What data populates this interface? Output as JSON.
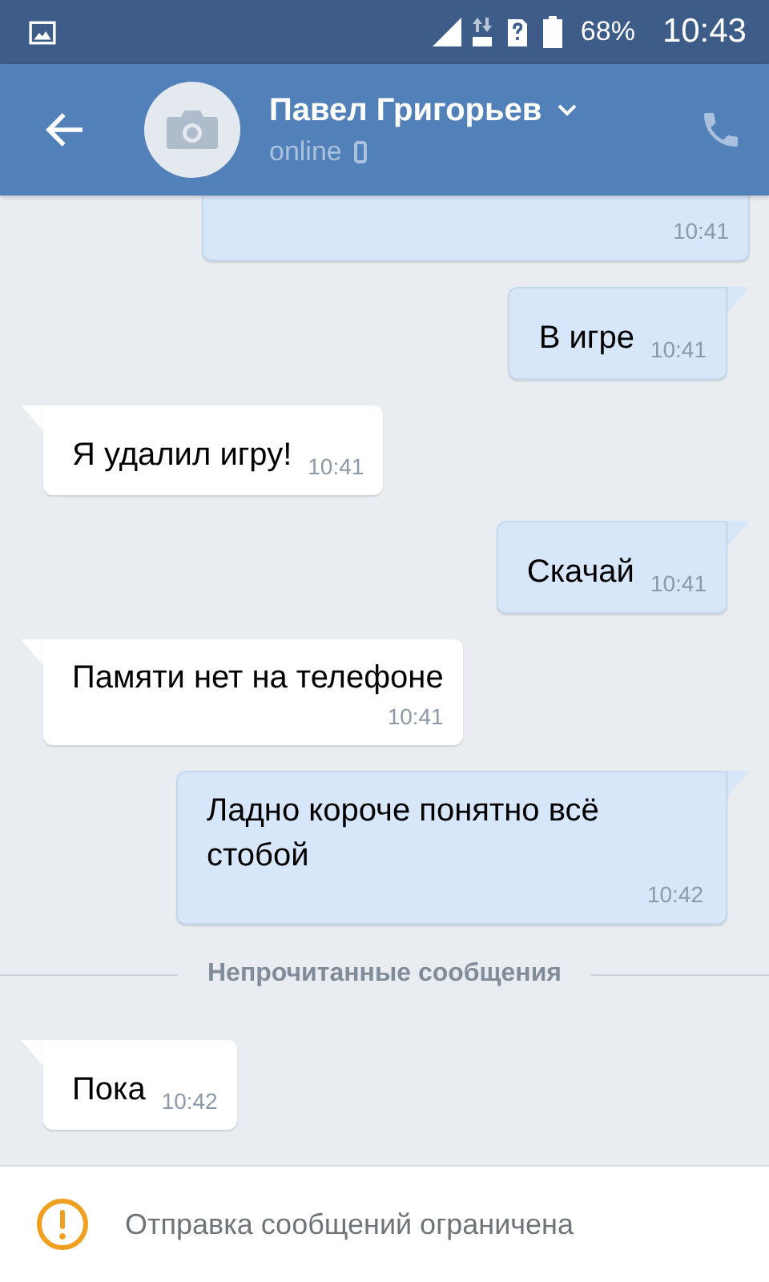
{
  "status_bar": {
    "battery": "68%",
    "time": "10:43"
  },
  "header": {
    "name": "Павел Григорьев",
    "status": "online"
  },
  "messages": [
    {
      "kind": "outgoing",
      "time": "10:41",
      "wrap": false
    },
    {
      "kind": "outgoing",
      "text": "В игре",
      "time": "10:41",
      "wrap": false
    },
    {
      "kind": "incoming",
      "text": "Я удалил игру!",
      "time": "10:41",
      "wrap": false
    },
    {
      "kind": "outgoing",
      "text": "Скачай",
      "time": "10:41",
      "wrap": false
    },
    {
      "kind": "incoming",
      "text": "Памяти нет на телефоне",
      "time": "10:41",
      "wrap": true
    },
    {
      "kind": "outgoing",
      "text": "Ладно короче понятно всё стобой",
      "time": "10:42",
      "wrap": true
    },
    {
      "kind": "divider",
      "text": "Непрочитанные сообщения"
    },
    {
      "kind": "incoming",
      "text": "Пока",
      "time": "10:42",
      "wrap": false
    }
  ],
  "notice": {
    "text": "Отправка сообщений ограничена"
  }
}
